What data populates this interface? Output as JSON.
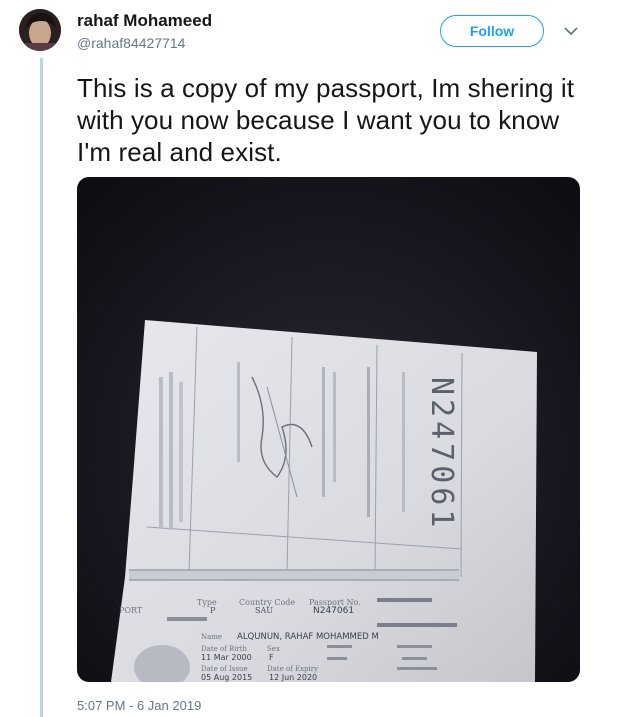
{
  "tweet": {
    "author_name": "rahaf Mohameed",
    "author_handle": "@rahaf84427714",
    "follow_label": "Follow",
    "text": "This is a copy of my passport, Im shering it with you now because I want you to know I'm real and exist.",
    "timestamp": "5:07 PM - 6 Jan 2019"
  },
  "passport": {
    "number_vertical": "N247061",
    "type_label": "Type",
    "type_value": "P",
    "country_code_label": "Country Code",
    "country_code_value": "SAU",
    "passport_no_label": "Passport No.",
    "passport_no_value": "N247061",
    "passport_word_left": "PORT",
    "name_label": "Name",
    "name_value": "ALQUNUN, RAHAF MOHAMMED M",
    "dob_label": "Date of Birth",
    "dob_value": "11 Mar 2000",
    "sex_label": "Sex",
    "sex_value": "F",
    "issue_label": "Date of Issue",
    "issue_value": "05 Aug 2015",
    "expiry_label": "Date of Expiry",
    "expiry_value": "12 Jun 2020"
  },
  "colors": {
    "accent": "#1da1f2",
    "thread_line": "#b3d4ea",
    "secondary_text": "#657786"
  },
  "icons": {
    "caret": "chevron-down-icon"
  }
}
